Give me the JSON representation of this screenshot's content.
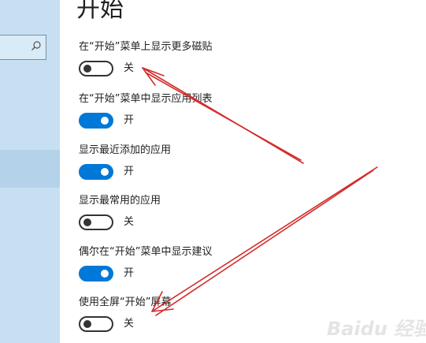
{
  "page": {
    "title": "开始"
  },
  "settings": [
    {
      "label": "在“开始”菜单上显示更多磁贴",
      "state": "关",
      "on": false
    },
    {
      "label": "在“开始”菜单中显示应用列表",
      "state": "开",
      "on": true
    },
    {
      "label": "显示最近添加的应用",
      "state": "开",
      "on": true
    },
    {
      "label": "显示最常用的应用",
      "state": "关",
      "on": false
    },
    {
      "label": "偶尔在“开始”菜单中显示建议",
      "state": "开",
      "on": true
    },
    {
      "label": "使用全屏“开始”屏幕",
      "state": "关",
      "on": false
    }
  ],
  "sidebar": {
    "search_icon": "search-icon"
  },
  "annotation": {
    "arrow_color": "#d42a2a"
  },
  "colors": {
    "accent": "#0078d7",
    "sidebar": "#c6e0f2"
  },
  "watermark": {
    "text": "Baidu 经验"
  }
}
